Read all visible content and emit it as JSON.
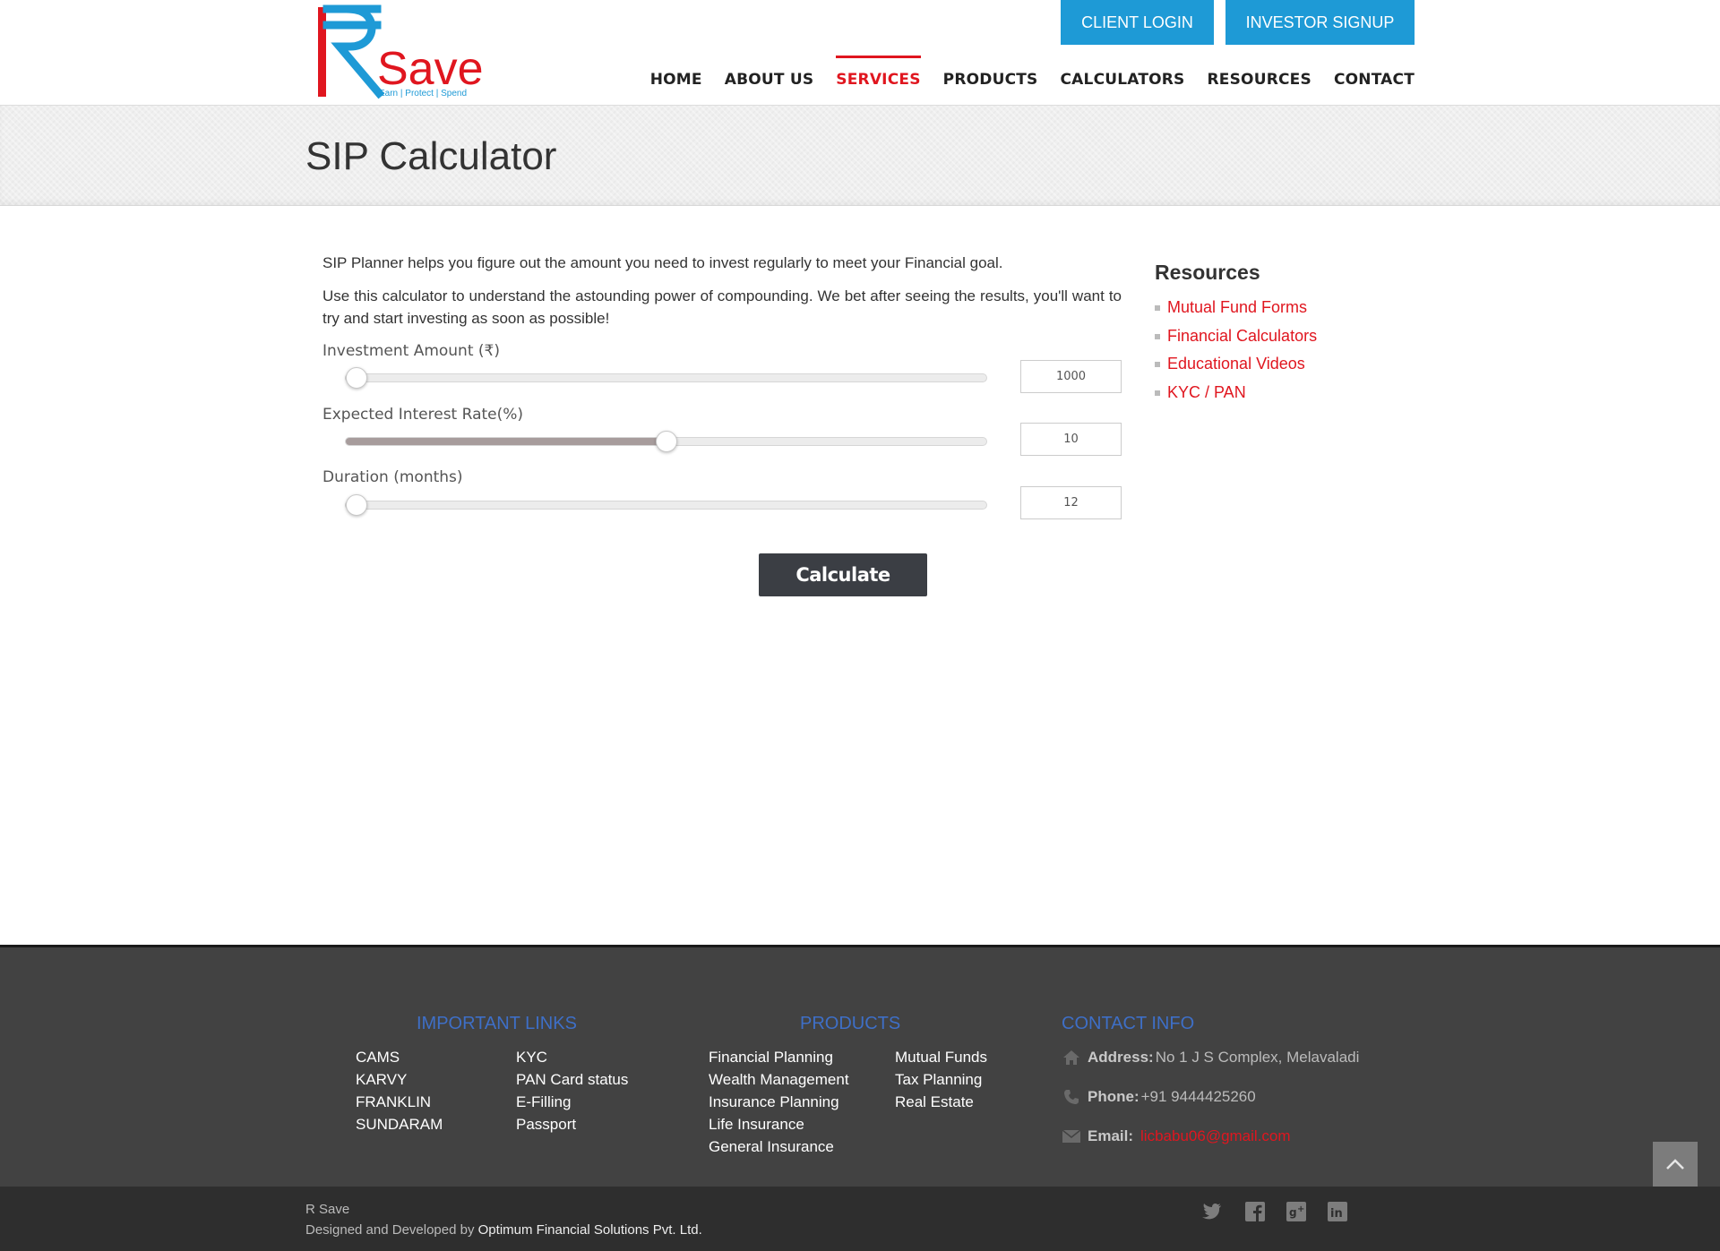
{
  "brand": {
    "logo_text": "Save",
    "logo_tagline": "Earn | Protect | Spend",
    "colors": {
      "red": "#e0161f",
      "blue": "#1e9ad6"
    }
  },
  "header": {
    "client_login": "CLIENT LOGIN",
    "investor_signup": "INVESTOR SIGNUP",
    "nav": [
      {
        "label": "HOME"
      },
      {
        "label": "ABOUT US"
      },
      {
        "label": "SERVICES",
        "active": true
      },
      {
        "label": "PRODUCTS"
      },
      {
        "label": "CALCULATORS"
      },
      {
        "label": "RESOURCES"
      },
      {
        "label": "CONTACT"
      }
    ]
  },
  "page": {
    "title": "SIP Calculator",
    "intro_1": "SIP Planner helps you figure out the amount you need to invest regularly to meet your Financial goal.",
    "intro_2": "Use this calculator to understand the astounding power of compounding. We bet after seeing the results, you'll want to try and start investing as soon as possible!"
  },
  "calculator": {
    "investment": {
      "label": "Investment Amount (₹)",
      "value": "1000",
      "level": 0.0
    },
    "interest": {
      "label": "Expected Interest Rate(%)",
      "value": "10",
      "level": 0.5
    },
    "duration": {
      "label": "Duration (months)",
      "value": "12",
      "level": 0.0
    },
    "button": "Calculate"
  },
  "resources": {
    "title": "Resources",
    "items": [
      "Mutual Fund Forms",
      "Financial Calculators",
      "Educational Videos",
      "KYC / PAN"
    ]
  },
  "footer": {
    "important_links": {
      "heading": "IMPORTANT LINKS",
      "col1": [
        "CAMS",
        "KARVY",
        "FRANKLIN",
        "SUNDARAM"
      ],
      "col2": [
        "KYC",
        "PAN Card status",
        "E-Filling",
        "Passport"
      ]
    },
    "products": {
      "heading": "PRODUCTS",
      "col1": [
        "Financial Planning",
        "Wealth Management",
        "Insurance Planning",
        "Life Insurance",
        "General Insurance"
      ],
      "col2": [
        "Mutual Funds",
        "Tax Planning",
        "Real Estate"
      ]
    },
    "contact": {
      "heading": "CONTACT INFO",
      "address_label": "Address:",
      "address": "No 1 J S Complex, Melavaladi",
      "phone_label": "Phone:",
      "phone": "+91 9444425260",
      "email_label": "Email:",
      "email": "licbabu06@gmail.com"
    },
    "copyright_name": "R Save",
    "designed_by": "Designed and Developed by ",
    "developer": "Optimum Financial Solutions Pvt. Ltd.",
    "social_icons": [
      "twitter-icon",
      "facebook-icon",
      "google-plus-icon",
      "linkedin-icon"
    ]
  }
}
